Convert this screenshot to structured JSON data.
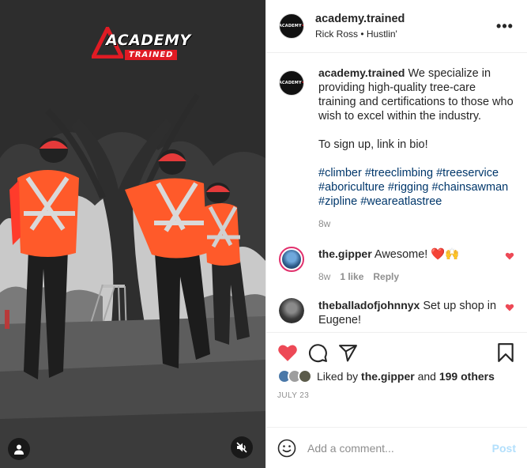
{
  "post": {
    "account": "academy.trained",
    "audio": "Rick Ross • Hustlin'",
    "more_label": "•••"
  },
  "media": {
    "brand_main": "ACADEMY",
    "brand_sub": "TRAINED",
    "tag_icon": "user-tag-icon",
    "mute_icon": "speaker-muted-icon"
  },
  "caption": {
    "username": "academy.trained",
    "text": "We specialize in providing high-quality tree-care training and certifications to those who wish to excel within the industry.",
    "signup": "To sign up, link in bio!",
    "hashtags": [
      "#climber",
      "#treeclimbing",
      "#treeservice",
      "#aboriculture",
      "#rigging",
      "#chainsawman",
      "#zipline",
      "#weareatlastree"
    ],
    "age": "8w"
  },
  "comments": [
    {
      "username": "the.gipper",
      "text": "Awesome! ❤️🙌",
      "age": "8w",
      "likes": "1 like",
      "reply": "Reply"
    },
    {
      "username": "theballadofjohnnyx",
      "text": "Set up shop in Eugene!"
    }
  ],
  "actions": {
    "like_icon": "heart-filled-icon",
    "comment_icon": "comment-bubble-icon",
    "share_icon": "paper-plane-icon",
    "save_icon": "bookmark-icon"
  },
  "likes": {
    "prefix": "Liked by",
    "user": "the.gipper",
    "and": "and",
    "others": "199 others"
  },
  "date": "July 23",
  "add_comment": {
    "placeholder": "Add a comment...",
    "post_label": "Post",
    "emoji_icon": "smiley-face-icon"
  },
  "colors": {
    "like_red": "#ed4956",
    "hashtag_blue": "#00376b",
    "vest_orange": "#ff5a2a",
    "post_disabled": "#b2dffc"
  }
}
